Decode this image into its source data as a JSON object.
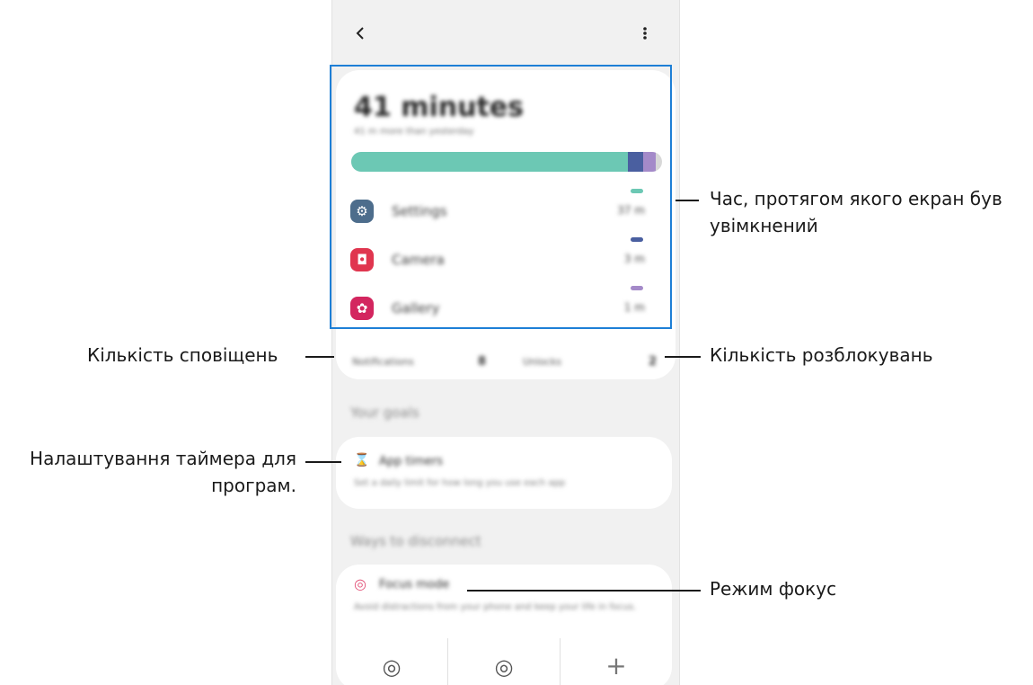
{
  "appbar": {
    "back_icon": "chevron-left-icon",
    "more_icon": "more-vert-icon"
  },
  "screen_time": {
    "total": "41 minutes",
    "subtitle": "41 m more than yesterday",
    "bar_segments": [
      {
        "color": "#6cc8b4",
        "fraction": 0.89
      },
      {
        "color": "#4a5fa0",
        "fraction": 0.05
      },
      {
        "color": "#a48ac9",
        "fraction": 0.04
      }
    ],
    "apps": [
      {
        "name": "Settings",
        "time": "37 m",
        "icon": "gear-icon",
        "icon_color": "#4d6d8c",
        "bar_color": "#6cc8b4"
      },
      {
        "name": "Camera",
        "time": "3 m",
        "icon": "camera-icon",
        "icon_color": "#e0364f",
        "bar_color": "#4a5fa0"
      },
      {
        "name": "Gallery",
        "time": "1 m",
        "icon": "flower-icon",
        "icon_color": "#d3265f",
        "bar_color": "#a48ac9"
      }
    ]
  },
  "stats": {
    "notifications_label": "Notifications",
    "notifications_value": "8",
    "unlocks_label": "Unlocks",
    "unlocks_value": "2"
  },
  "goals": {
    "section_title": "Your goals",
    "app_timers_title": "App timers",
    "app_timers_desc": "Set a daily limit for how long you use each app",
    "app_timers_icon": "hourglass-icon"
  },
  "disconnect": {
    "section_title": "Ways to disconnect",
    "focus_title": "Focus mode",
    "focus_desc": "Avoid distractions from your phone and keep your life in focus.",
    "focus_icon": "focus-target-icon",
    "buttons": [
      {
        "icon": "work-focus-icon",
        "glyph": "◎"
      },
      {
        "icon": "me-time-focus-icon",
        "glyph": "◎"
      },
      {
        "icon": "add-icon",
        "glyph": "+"
      }
    ]
  },
  "callouts": {
    "screen_on_line1": "Час, протягом якого екран був",
    "screen_on_line2": "увімкнений",
    "notifications": "Кількість сповіщень",
    "unlocks": "Кількість розблокувань",
    "timers_line1": "Налаштування таймера для",
    "timers_line2": "програм.",
    "focus_mode": "Режим фокус"
  },
  "colors": {
    "highlight": "#1e7fd6",
    "accent_teal": "#6cc8b4"
  }
}
